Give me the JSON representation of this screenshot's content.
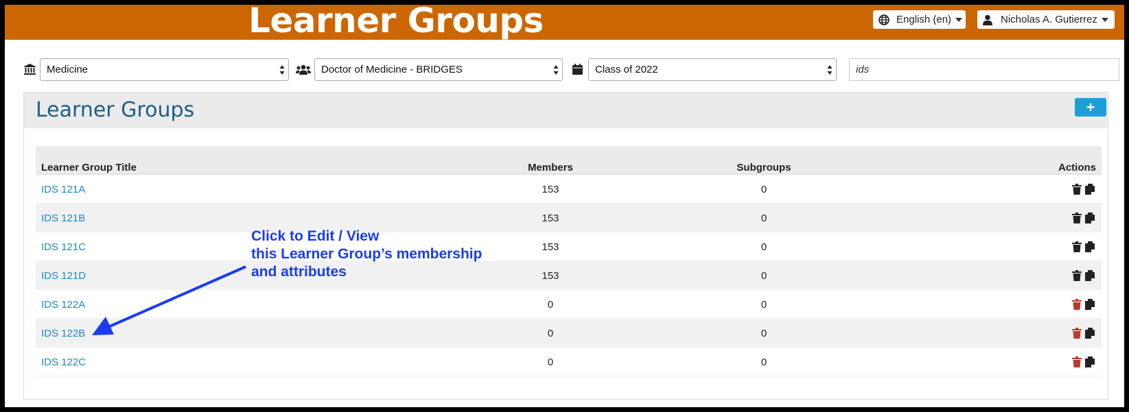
{
  "header": {
    "title": "Learner Groups",
    "language": "English (en)",
    "user": "Nicholas A. Gutierrez",
    "bg_color": "#cc6600"
  },
  "filters": {
    "school": "Medicine",
    "program": "Doctor of Medicine - BRIDGES",
    "cohort": "Class of 2022",
    "search_value": "ids"
  },
  "panel": {
    "title": "Learner Groups",
    "add_label": "+"
  },
  "table": {
    "columns": {
      "title": "Learner Group Title",
      "members": "Members",
      "subgroups": "Subgroups",
      "actions": "Actions"
    },
    "rows": [
      {
        "title": "IDS 121A",
        "members": "153",
        "subgroups": "0",
        "deletable": false
      },
      {
        "title": "IDS 121B",
        "members": "153",
        "subgroups": "0",
        "deletable": false
      },
      {
        "title": "IDS 121C",
        "members": "153",
        "subgroups": "0",
        "deletable": false
      },
      {
        "title": "IDS 121D",
        "members": "153",
        "subgroups": "0",
        "deletable": false
      },
      {
        "title": "IDS 122A",
        "members": "0",
        "subgroups": "0",
        "deletable": true
      },
      {
        "title": "IDS 122B",
        "members": "0",
        "subgroups": "0",
        "deletable": true
      },
      {
        "title": "IDS 122C",
        "members": "0",
        "subgroups": "0",
        "deletable": true
      }
    ]
  },
  "annotation": {
    "line1": "Click to Edit / View",
    "line2": "this Learner Group’s membership",
    "line3": "and attributes",
    "color": "#1a3cf0"
  },
  "icons": {
    "language": "globe-icon",
    "user": "user-icon",
    "school": "institution-icon",
    "program": "users-icon",
    "cohort": "calendar-icon",
    "delete": "trash-icon",
    "copy": "copy-icon"
  },
  "colors": {
    "link": "#1c8ac6",
    "panel_title": "#1e5f86",
    "add_button": "#1c9fd6",
    "trash_active": "#b83a30",
    "trash_disabled": "#222222"
  }
}
